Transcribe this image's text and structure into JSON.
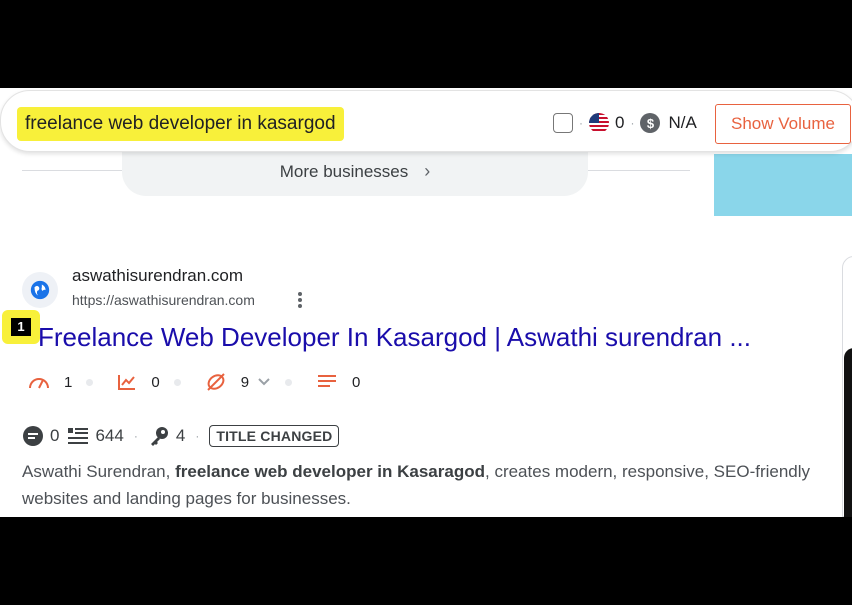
{
  "search": {
    "query": "freelance web developer in kasargod",
    "country_count": "0",
    "cpc": "N/A",
    "cpc_symbol": "$",
    "show_volume_label": "Show Volume"
  },
  "more_businesses": {
    "label": "More businesses",
    "chevron": "›"
  },
  "result": {
    "site_name": "aswathisurendran.com",
    "url": "https://aswathisurendran.com",
    "rank": "1",
    "title": "Freelance Web Developer In Kasargod | Aswathi surendran ...",
    "metrics": {
      "speed": "1",
      "traffic": "0",
      "links": "9",
      "headings": "0"
    },
    "info": {
      "comments": "0",
      "words": "644",
      "keywords": "4",
      "badge": "TITLE CHANGED"
    },
    "snippet_pre": "Aswathi Surendran, ",
    "snippet_bold": "freelance web developer in Kasaragod",
    "snippet_post": ", creates modern, responsive, SEO-friendly websites and landing pages for businesses."
  },
  "colors": {
    "highlight": "#f8f03a",
    "link": "#1a0dab",
    "accent": "#e8623f",
    "side_box": "#8ad6ea"
  },
  "icons": [
    "globe-icon",
    "more-vert-icon",
    "gauge-icon",
    "trend-chart-icon",
    "link-off-icon",
    "lines-icon",
    "comment-icon",
    "list-icon",
    "key-icon",
    "chevron-down-icon",
    "us-flag-icon",
    "dollar-coin-icon"
  ]
}
